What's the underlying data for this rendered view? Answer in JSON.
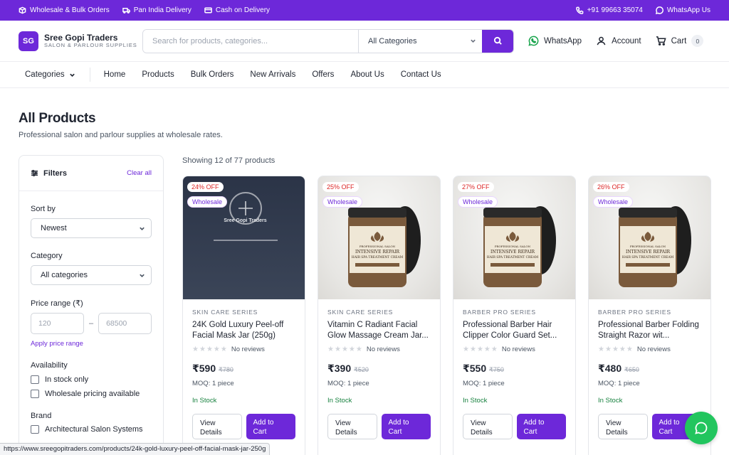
{
  "topbar": {
    "wholesale": "Wholesale & Bulk Orders",
    "delivery": "Pan India Delivery",
    "cod": "Cash on Delivery",
    "phone": "+91 99663 35074",
    "whatsapp": "WhatsApp Us"
  },
  "brand": {
    "initials": "SG",
    "name": "Sree Gopi Traders",
    "tagline": "SALON & PARLOUR SUPPLIES"
  },
  "search": {
    "placeholder": "Search for products, categories...",
    "category": "All Categories"
  },
  "header_actions": {
    "whatsapp": "WhatsApp",
    "account": "Account",
    "cart": "Cart",
    "cart_count": "0"
  },
  "nav": {
    "categories": "Categories",
    "links": [
      "Home",
      "Products",
      "Bulk Orders",
      "New Arrivals",
      "Offers",
      "About Us",
      "Contact Us"
    ]
  },
  "page": {
    "title": "All Products",
    "subtitle": "Professional salon and parlour supplies at wholesale rates.",
    "showing": "Showing 12 of 77 products"
  },
  "filters": {
    "title": "Filters",
    "clear": "Clear all",
    "sort_label": "Sort by",
    "sort_value": "Newest",
    "category_label": "Category",
    "category_value": "All categories",
    "price_label": "Price range (₹)",
    "price_min": "120",
    "price_dash": "–",
    "price_max": "68500",
    "apply": "Apply price range",
    "availability_label": "Availability",
    "in_stock": "In stock only",
    "wholesale": "Wholesale pricing available",
    "brand_label": "Brand",
    "brand_first": "Architectural Salon Systems"
  },
  "products": [
    {
      "discount": "24% OFF",
      "tag": "Wholesale",
      "series": "SKIN CARE SERIES",
      "name": "24K Gold Luxury Peel-off Facial Mask Jar (250g)",
      "reviews": "No reviews",
      "price": "₹590",
      "mrp": "₹780",
      "moq": "MOQ: 1 piece",
      "stock": "In Stock",
      "view": "View Details",
      "add": "Add to Cart",
      "placeholder_text": "Sree Gopi Traders",
      "image": "placeholder"
    },
    {
      "discount": "25% OFF",
      "tag": "Wholesale",
      "series": "SKIN CARE SERIES",
      "name": "Vitamin C Radiant Facial Glow Massage Cream Jar...",
      "reviews": "No reviews",
      "price": "₹390",
      "mrp": "₹520",
      "moq": "MOQ: 1 piece",
      "stock": "In Stock",
      "view": "View Details",
      "add": "Add to Cart",
      "image": "jar"
    },
    {
      "discount": "27% OFF",
      "tag": "Wholesale",
      "series": "BARBER PRO SERIES",
      "name": "Professional Barber Hair Clipper Color Guard Set...",
      "reviews": "No reviews",
      "price": "₹550",
      "mrp": "₹750",
      "moq": "MOQ: 1 piece",
      "stock": "In Stock",
      "view": "View Details",
      "add": "Add to Cart",
      "image": "jar"
    },
    {
      "discount": "26% OFF",
      "tag": "Wholesale",
      "series": "BARBER PRO SERIES",
      "name": "Professional Barber Folding Straight Razor wit...",
      "reviews": "No reviews",
      "price": "₹480",
      "mrp": "₹650",
      "moq": "MOQ: 1 piece",
      "stock": "In Stock",
      "view": "View Details",
      "add": "Add to Cart",
      "image": "jar"
    }
  ],
  "jar_label": {
    "line1": "PROFESSIONAL SALON",
    "line2": "INTENSIVE REPAIR",
    "line3": "HAIR SPA TREATMENT CREAM"
  },
  "status_url": "https://www.sreegopitraders.com/products/24k-gold-luxury-peel-off-facial-mask-jar-250g",
  "colors": {
    "brand": "#6d28d9",
    "whatsapp": "#22c55e",
    "discount": "#dc2626",
    "stock": "#15803d"
  }
}
